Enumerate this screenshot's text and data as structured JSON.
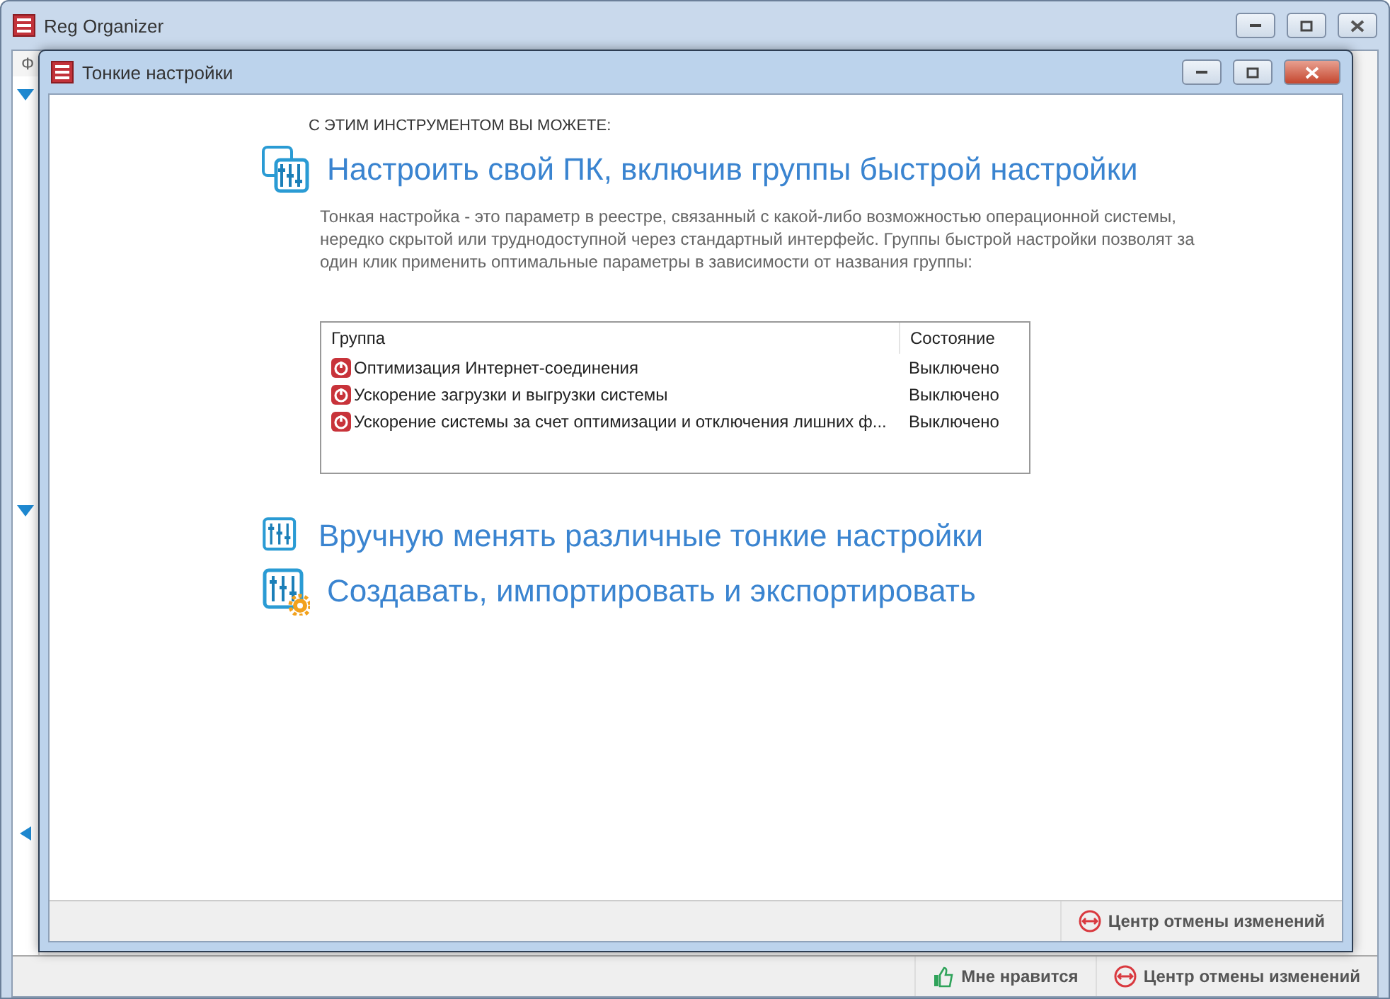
{
  "window": {
    "title": "Reg Organizer",
    "menu": [
      "Ф"
    ]
  },
  "dialog": {
    "title": "Тонкие настройки",
    "intro": "С ЭТИМ ИНСТРУМЕНТОМ ВЫ МОЖЕТЕ:",
    "sections": [
      {
        "kind": "groups",
        "title": "Настроить свой ПК, включив группы быстрой настройки",
        "description": "Тонкая настройка - это параметр в реестре, связанный с какой-либо возможностью операционной системы, нередко скрытой или труднодоступной через стандартный интерфейс. Группы быстрой настройки позволят за один клик применить оптимальные параметры в зависимости от названия группы:",
        "table": {
          "columns": [
            "Группа",
            "Состояние"
          ],
          "rows": [
            {
              "group": "Оптимизация Интернет-соединения",
              "state": "Выключено",
              "enabled": false
            },
            {
              "group": "Ускорение загрузки и выгрузки системы",
              "state": "Выключено",
              "enabled": false
            },
            {
              "group": "Ускорение системы за счет оптимизации и отключения лишних ф...",
              "state": "Выключено",
              "enabled": false
            }
          ]
        }
      },
      {
        "kind": "manual",
        "title": "Вручную менять различные тонкие настройки"
      },
      {
        "kind": "import",
        "title": "Создавать, импортировать и экспортировать"
      }
    ],
    "status_bar": {
      "undo_center": "Центр отмены изменений"
    }
  },
  "status_bar": {
    "like": "Мне нравится",
    "undo_center": "Центр отмены изменений"
  }
}
